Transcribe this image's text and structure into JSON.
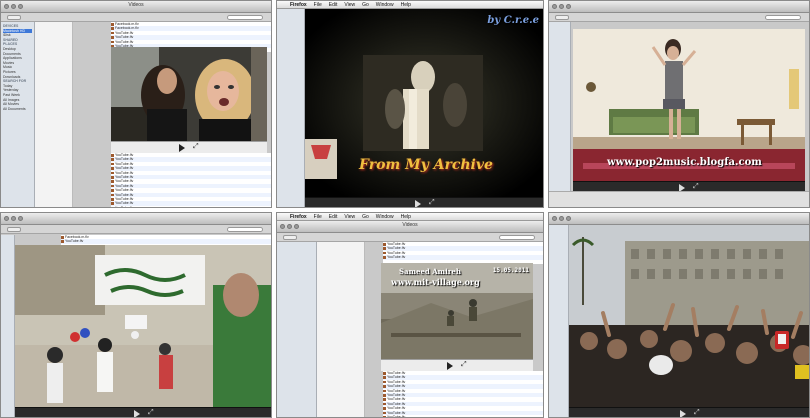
{
  "tiles": {
    "top_left": {
      "window_title": "Videos",
      "sidebar_items": [
        "DEVICES",
        "Macintosh HD",
        "iDisk",
        "SHARED",
        "PLACES",
        "Desktop",
        "Documents",
        "Applications",
        "Movies",
        "Music",
        "Pictures",
        "Downloads",
        "SEARCH FOR",
        "Today",
        "Yesterday",
        "Past Week",
        "All Images",
        "All Movies",
        "All Documents"
      ],
      "file_rows": [
        "Facebook.m.flv",
        "Facebook.m.flv",
        "YouTube.flv",
        "YouTube.flv",
        "YouTube.flv",
        "YouTube.flv",
        "YouTube.flv",
        "YouTube.flv",
        "YouTube.flv",
        "YouTube.flv",
        "YouTube.flv",
        "YouTube.flv",
        "YouTube.flv",
        "YouTube.flv",
        "YouTube.flv",
        "YouTube.flv",
        "YouTube.flv",
        "YouTube.flv",
        "YouTube.flv",
        "YouTube.flv"
      ]
    },
    "top_center": {
      "menu": [
        "Firefox",
        "File",
        "Edit",
        "View",
        "Go",
        "Window",
        "Help"
      ],
      "watermark_main": "From My Archive",
      "watermark_top": "by C.r.e.e"
    },
    "top_right": {
      "watermark": "www.pop2music.blogfa.com"
    },
    "bottom_left": {
      "file_rows": [
        "Facebook.m.flv",
        "YouTube.flv"
      ]
    },
    "bottom_center": {
      "menu": [
        "Firefox",
        "File",
        "Edit",
        "View",
        "Go",
        "Window",
        "Help"
      ],
      "window_title": "Videos",
      "watermark_brand": "Sameed Amireh",
      "watermark_url": "www.mit-village.org",
      "watermark_date": "15.05.2011",
      "file_rows": [
        "YouTube.flv",
        "YouTube.flv",
        "YouTube.flv",
        "YouTube.flv",
        "YouTube.flv",
        "YouTube.flv",
        "YouTube.flv",
        "YouTube.flv",
        "YouTube.flv",
        "YouTube.flv",
        "YouTube.flv",
        "YouTube.flv",
        "YouTube.flv",
        "YouTube.flv",
        "YouTube.flv"
      ]
    },
    "bottom_right": {}
  },
  "controls": {
    "play_icon": "play-icon",
    "fullscreen_icon": "expand-icon"
  },
  "colors": {
    "selection": "#3d78d8",
    "sidebar_bg": "#dde3ea",
    "chrome": "#d5d5d5"
  }
}
